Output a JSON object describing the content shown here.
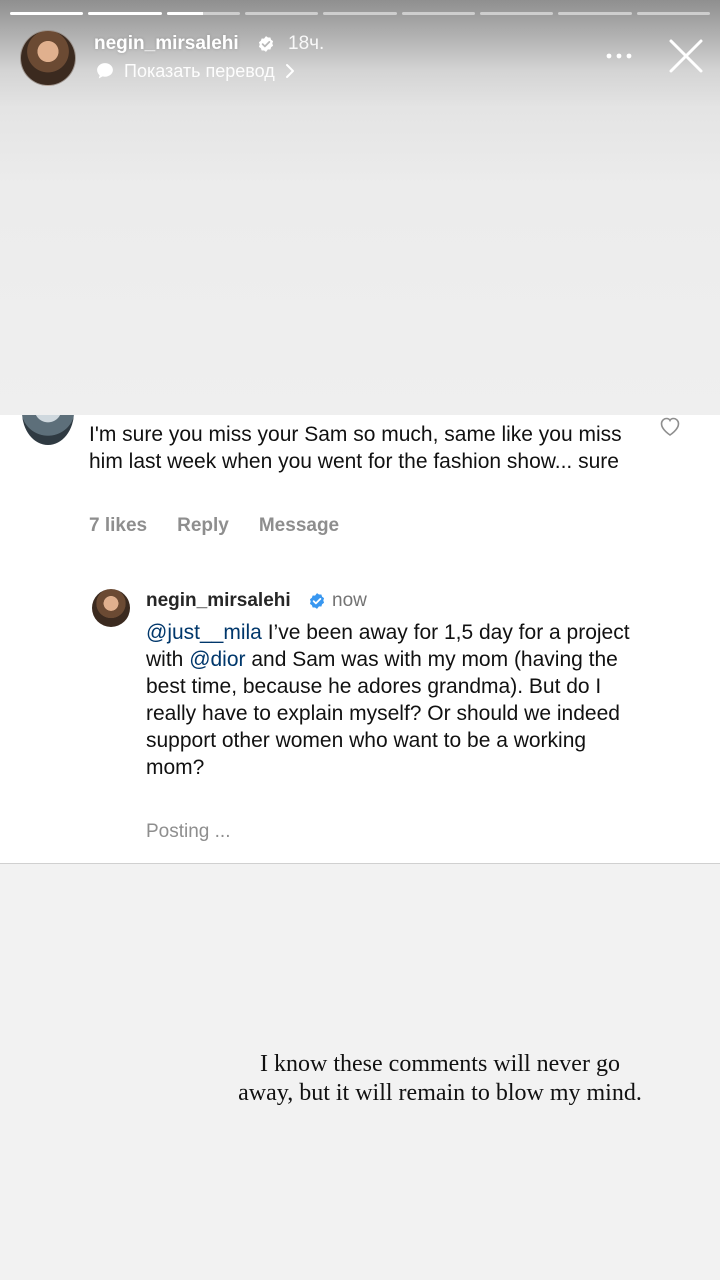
{
  "story": {
    "progress": [
      1,
      1,
      0.5,
      0,
      0,
      0,
      0,
      0,
      0
    ],
    "username": "negin_mirsalehi",
    "time": "18ч.",
    "translate_label": "Показать перевод",
    "icons": {
      "verified": "verified-badge-icon",
      "translate": "translate-icon",
      "more": "more-dots-icon",
      "close": "close-icon"
    }
  },
  "comment": {
    "text": "I'm  sure you miss your Sam so much, same like you miss him last week when you went for the fashion show... sure",
    "likes_label": "7 likes",
    "reply_label": "Reply",
    "message_label": "Message"
  },
  "reply": {
    "username": "negin_mirsalehi",
    "time": "now",
    "mention_user": "@just__mila",
    "text_part1": " I’ve been away for 1,5 day for a project with ",
    "mention_brand": "@dior",
    "text_part2": " and Sam was with my mom (having the best time, because he adores grandma). But do I really have to explain myself? Or should we indeed support other women who want to be a working mom?",
    "status": "Posting ..."
  },
  "caption": "I know these comments will never go away, but it will remain to blow my mind.",
  "colors": {
    "verified": "#3897f0",
    "mention": "#00376b",
    "secondary_text": "#8e8e8e"
  }
}
